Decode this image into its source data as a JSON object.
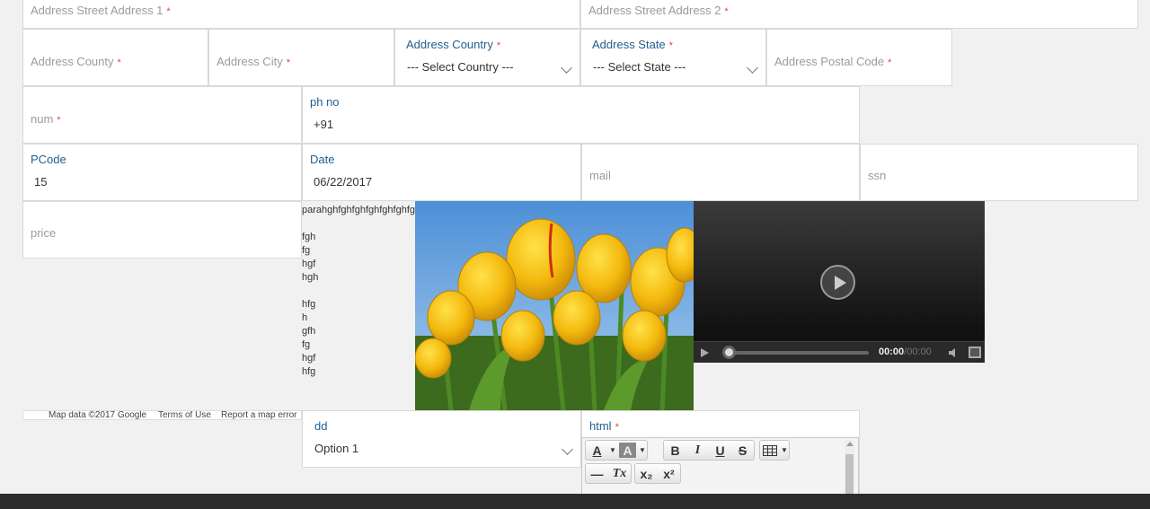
{
  "address": {
    "street1": "Address Street Address 1",
    "street2": "Address Street Address 2",
    "county": "Address County",
    "city": "Address City",
    "country_label": "Address Country",
    "country_value": "--- Select Country ---",
    "state_label": "Address State",
    "state_value": "--- Select State ---",
    "postal": "Address Postal Code",
    "required_mark": "*"
  },
  "fields": {
    "num": "num",
    "phone_label": "ph no",
    "phone_value": "+91",
    "pcode_label": "PCode",
    "pcode_value": "15",
    "date_label": "Date",
    "date_value": "06/22/2017",
    "mail": "mail",
    "ssn": "ssn",
    "price": "price",
    "dd_label": "dd",
    "dd_value": "Option 1",
    "html_label": "html"
  },
  "paragraph": {
    "lines": [
      "parahghfghfghfghfghfghfg",
      "",
      "fgh",
      "fg",
      "hgf",
      "hgh",
      "",
      "hfg",
      "h",
      "gfh",
      "fg",
      "hgf",
      "hfg"
    ]
  },
  "map": {
    "data_text": "Map data ©2017 Google",
    "terms": "Terms of Use",
    "report": "Report a map error"
  },
  "video": {
    "time_current": "00:00",
    "time_total": "/00:00"
  },
  "editor": {
    "buttons": [
      "A",
      "A",
      "B",
      "I",
      "U",
      "S",
      "—",
      "Tx",
      "x₂",
      "x²"
    ]
  },
  "colors": {
    "label": "#1f5e91",
    "required": "#e0453a",
    "placeholder": "#9b9b9b"
  }
}
